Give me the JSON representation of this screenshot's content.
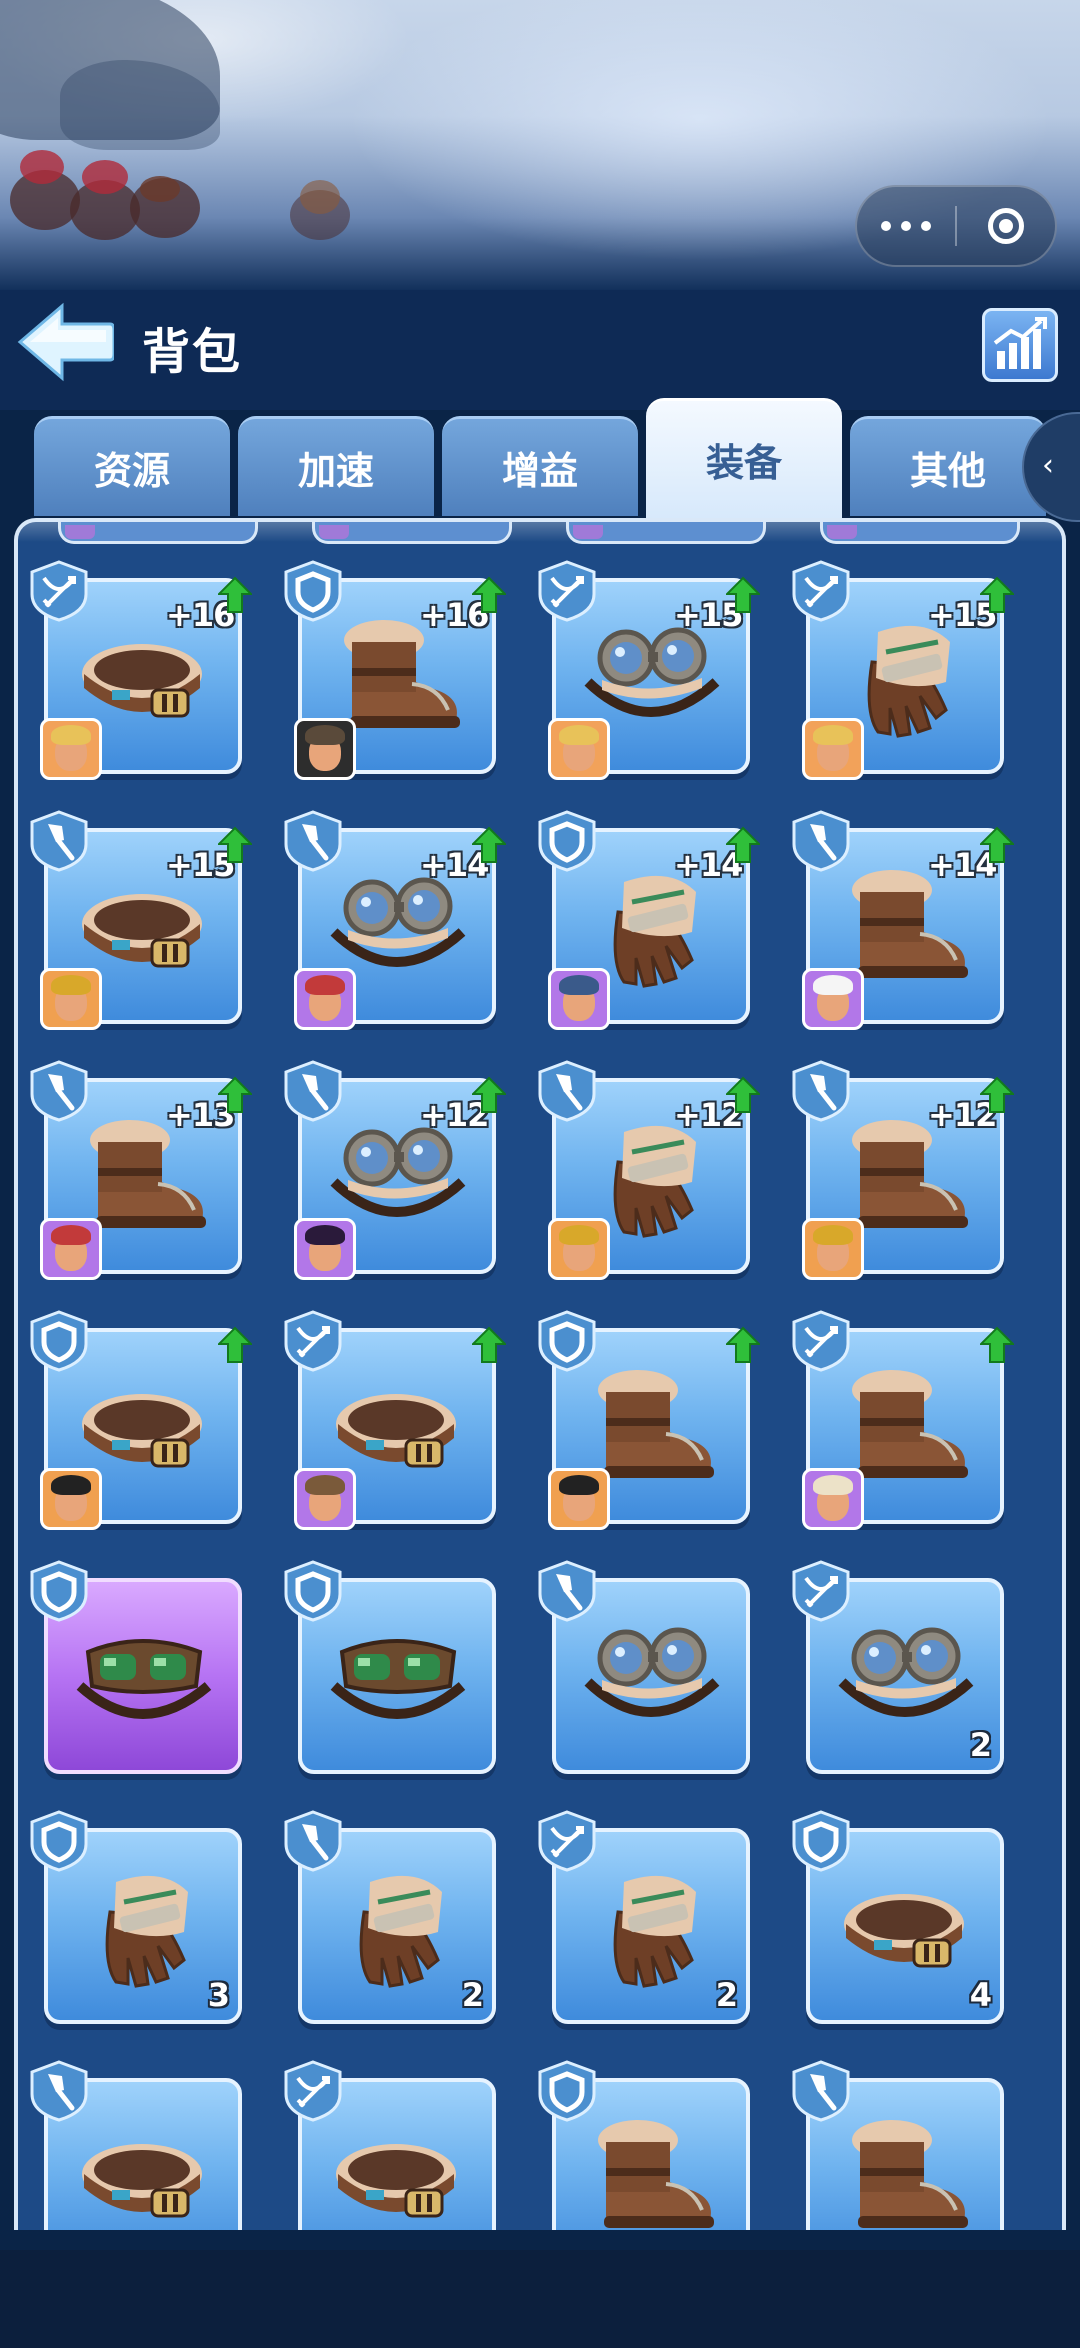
{
  "header": {
    "title": "背包"
  },
  "tabs": [
    {
      "label": "资源",
      "active": false
    },
    {
      "label": "加速",
      "active": false
    },
    {
      "label": "增益",
      "active": false
    },
    {
      "label": "装备",
      "active": true
    },
    {
      "label": "其他",
      "active": false
    }
  ],
  "colors": {
    "accent": "#1d4a86",
    "card_blue": "#6fb3ef",
    "card_purple": "#b673f3",
    "upgrade_green": "#2fbf3a"
  },
  "rows": [
    [
      {
        "badge": "crossbow-icon",
        "item": "belt",
        "level": "+16",
        "upgradable": true,
        "hero": "blonde-hero"
      },
      {
        "badge": "shield-icon",
        "item": "boots",
        "level": "+16",
        "upgradable": true,
        "hero": "goggles-hero"
      },
      {
        "badge": "crossbow-icon",
        "item": "goggles",
        "level": "+15",
        "upgradable": true,
        "hero": "blonde-hero"
      },
      {
        "badge": "crossbow-icon",
        "item": "gloves",
        "level": "+15",
        "upgradable": true,
        "hero": "blonde-hero"
      }
    ],
    [
      {
        "badge": "shovel-icon",
        "item": "belt",
        "level": "+15",
        "upgradable": true,
        "hero": "miner-hero"
      },
      {
        "badge": "shovel-icon",
        "item": "goggles",
        "level": "+14",
        "upgradable": true,
        "hero": "red-hat-hero"
      },
      {
        "badge": "shield-icon",
        "item": "gloves",
        "level": "+14",
        "upgradable": true,
        "hero": "helmet-hero"
      },
      {
        "badge": "shovel-icon",
        "item": "boots",
        "level": "+14",
        "upgradable": true,
        "hero": "chef-hero"
      }
    ],
    [
      {
        "badge": "shovel-icon",
        "item": "boots",
        "level": "+13",
        "upgradable": true,
        "hero": "red-hat-hero"
      },
      {
        "badge": "shovel-icon",
        "item": "goggles",
        "level": "+12",
        "upgradable": true,
        "hero": "dark-hair-hero"
      },
      {
        "badge": "shovel-icon",
        "item": "gloves",
        "level": "+12",
        "upgradable": true,
        "hero": "miner-hero"
      },
      {
        "badge": "shovel-icon",
        "item": "boots",
        "level": "+12",
        "upgradable": true,
        "hero": "miner-hero"
      }
    ],
    [
      {
        "badge": "shield-icon",
        "item": "belt",
        "level": "",
        "upgradable": true,
        "hero": "tophat-hero"
      },
      {
        "badge": "crossbow-icon",
        "item": "belt",
        "level": "",
        "upgradable": true,
        "hero": "aviator-hero"
      },
      {
        "badge": "shield-icon",
        "item": "boots",
        "level": "",
        "upgradable": true,
        "hero": "tophat-hero"
      },
      {
        "badge": "crossbow-icon",
        "item": "boots",
        "level": "",
        "upgradable": true,
        "hero": "turban-hero"
      }
    ],
    [
      {
        "badge": "shield-icon",
        "item": "goggles-green",
        "count": "",
        "rarity": "purple"
      },
      {
        "badge": "shield-icon",
        "item": "goggles-green",
        "count": ""
      },
      {
        "badge": "shovel-icon",
        "item": "goggles",
        "count": ""
      },
      {
        "badge": "crossbow-icon",
        "item": "goggles",
        "count": "2"
      }
    ],
    [
      {
        "badge": "shield-icon",
        "item": "gloves",
        "count": "3"
      },
      {
        "badge": "shovel-icon",
        "item": "gloves",
        "count": "2"
      },
      {
        "badge": "crossbow-icon",
        "item": "gloves",
        "count": "2"
      },
      {
        "badge": "shield-icon",
        "item": "belt",
        "count": "4"
      }
    ],
    [
      {
        "badge": "shovel-icon",
        "item": "belt",
        "count": ""
      },
      {
        "badge": "crossbow-icon",
        "item": "belt",
        "count": ""
      },
      {
        "badge": "shield-icon",
        "item": "boots",
        "count": ""
      },
      {
        "badge": "shovel-icon",
        "item": "boots",
        "count": ""
      }
    ]
  ]
}
